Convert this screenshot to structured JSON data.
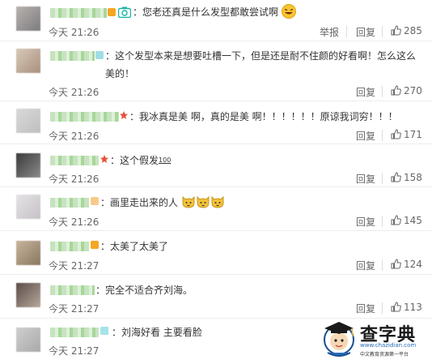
{
  "comments": [
    {
      "text": "：您老还真是什么发型都敢尝试啊",
      "time": "今天 21:26",
      "report_label": "举报",
      "reply_label": "回复",
      "likes": "285"
    },
    {
      "text": "：这个发型本来是想要吐槽一下，但是还是耐不住颜的好看啊！怎么这么美的！",
      "time": "今天 21:26",
      "reply_label": "回复",
      "likes": "270"
    },
    {
      "text": "：我冰真是美 啊，真的是美 啊！！！！！！原谅我词穷！！！",
      "time": "今天 21:26",
      "reply_label": "回复",
      "likes": "171"
    },
    {
      "text": "：这个假发",
      "suffix": "100",
      "time": "今天 21:26",
      "reply_label": "回复",
      "likes": "158"
    },
    {
      "text": "：画里走出来的人",
      "time": "今天 21:26",
      "reply_label": "回复",
      "likes": "145"
    },
    {
      "text": "：太美了太美了",
      "time": "今天 21:27",
      "reply_label": "回复",
      "likes": "124"
    },
    {
      "text": "：完全不适合齐刘海。",
      "time": "今天 21:27",
      "reply_label": "回复",
      "likes": "113"
    },
    {
      "text": "：刘海好看 主要看脸",
      "time": "今天 21:27"
    }
  ],
  "watermark": {
    "title": "查字典",
    "url": "www.chazidian.com",
    "sub": "中文教育资源第一平台"
  },
  "colors": {
    "text": "#333333",
    "muted": "#666666",
    "divider": "#ededed",
    "watermark_blue": "#2a6db8"
  }
}
